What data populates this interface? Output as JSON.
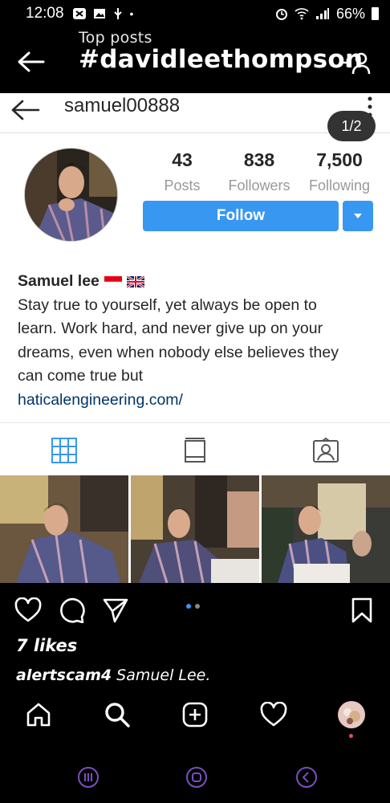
{
  "status_bar": {
    "time": "12:08",
    "battery": "66%"
  },
  "header": {
    "subtitle": "Top posts",
    "hashtag": "#davidleethompson"
  },
  "profile": {
    "username": "samuel00888",
    "pager": "1/2",
    "stats": [
      {
        "num": "43",
        "label": "Posts"
      },
      {
        "num": "838",
        "label": "Followers"
      },
      {
        "num": "7,500",
        "label": "Following"
      }
    ],
    "follow_label": "Follow",
    "bio": {
      "name": "Samuel lee",
      "flags": [
        "indonesia-flag",
        "uk-flag"
      ],
      "text_lines": [
        "Stay true to yourself, yet always be open to",
        "learn. Work hard, and never give up on your",
        "dreams, even when nobody else believes they",
        "can come true but"
      ],
      "link": "haticalengineering.com/"
    },
    "tabs": [
      "grid-icon",
      "portrait-icon",
      "tagged-icon"
    ]
  },
  "post": {
    "likes": "7 likes",
    "caption_user": "alertscam4",
    "caption_text": " Samuel Lee."
  },
  "colors": {
    "accent": "#3897f0",
    "link": "#003569",
    "notification": "#ed4956"
  }
}
